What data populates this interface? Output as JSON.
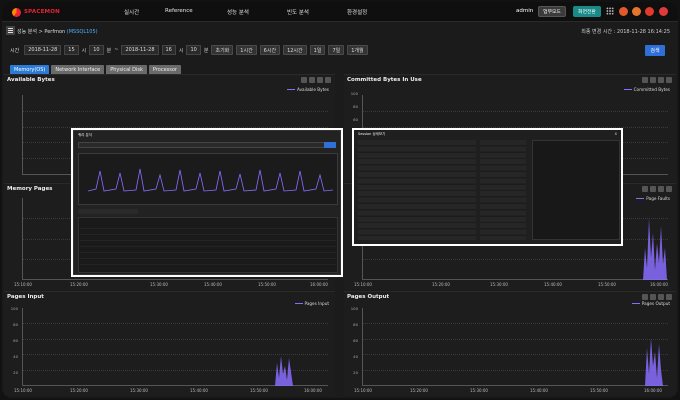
{
  "brand": {
    "logo_text": "SPACEMON"
  },
  "nav": {
    "items": [
      "실시간",
      "Reference",
      "성능 분석",
      "빈도 분석",
      "환경설정"
    ],
    "user": "admin",
    "btn_work": "업무모드",
    "btn_dashboard": "화면전환"
  },
  "breadcrumb": {
    "path": "성능 분석 > Perfmon",
    "sid": "(MSSQL105)"
  },
  "last_update": {
    "label": "최종 변경 시간 : 2018-11-28 16:14:25"
  },
  "filter": {
    "label": "시간",
    "from_date": "2018-11-28",
    "from_hour": "15",
    "from_hour_unit": "시",
    "from_min": "10",
    "from_min_unit": "분",
    "sep": "~",
    "to_date": "2018-11-28",
    "to_hour": "16",
    "to_hour_unit": "시",
    "to_min": "10",
    "to_min_unit": "분",
    "quick": [
      "초기화",
      "1시간",
      "6시간",
      "12시간",
      "1일",
      "7일",
      "1개월"
    ],
    "search": "검색"
  },
  "tabs": [
    "Memory(OS)",
    "Network Interface",
    "Physical Disk",
    "Processor"
  ],
  "panels": {
    "available_bytes": {
      "title": "Available Bytes",
      "legend": "Available Bytes"
    },
    "committed_bytes": {
      "title": "Committed Bytes In Use",
      "legend": "Committed Bytes"
    },
    "memory_pages": {
      "title": "Memory Pages"
    },
    "page_faults": {
      "legend": "Page Faults"
    },
    "pages_input": {
      "title": "Pages Input",
      "legend": "Pages Input"
    },
    "pages_output": {
      "title": "Pages Output",
      "legend": "Pages Output"
    }
  },
  "y_ticks": {
    "top": [
      "1,000",
      "900",
      "800",
      "700",
      "600",
      "500",
      "400",
      "300",
      "200",
      "100",
      "0"
    ],
    "mid_left": [
      "100",
      "90",
      "80",
      "70",
      "60",
      "50",
      "40",
      "30",
      "20",
      "10"
    ],
    "bottom": [
      "100",
      "80",
      "60",
      "40",
      "20",
      "0"
    ]
  },
  "x_ticks": [
    "15:10:00",
    "15:20:00",
    "15:30:00",
    "15:40:00",
    "15:50:00",
    "16:00:00",
    "16:10:00"
  ],
  "popup_left": {
    "title": "쿼리 분석"
  },
  "popup_right": {
    "title": "Session 상세보기",
    "close": "x"
  },
  "colors": {
    "accent": "#2b7ad6",
    "series": "#8a6cff",
    "teal": "#1a8a88"
  }
}
